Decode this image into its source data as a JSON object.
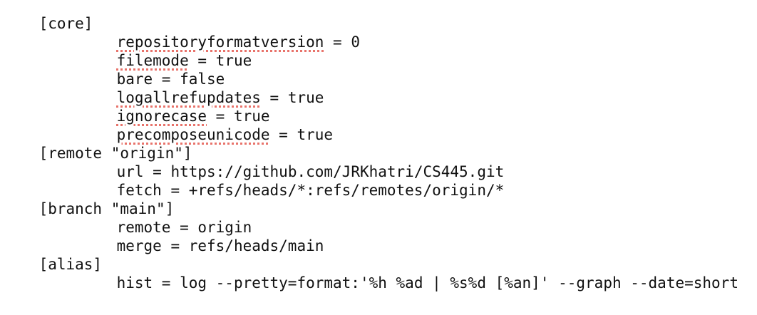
{
  "document": {
    "lines": [
      {
        "type": "section",
        "text": "[core]"
      },
      {
        "type": "kv",
        "key": "repositoryformatversion",
        "sep": " = ",
        "value": "0",
        "misspelled": true
      },
      {
        "type": "kv",
        "key": "filemode",
        "sep": " = ",
        "value": "true",
        "misspelled": true
      },
      {
        "type": "kv",
        "key": "bare",
        "sep": " = ",
        "value": "false",
        "misspelled": false
      },
      {
        "type": "kv",
        "key": "logallrefupdates",
        "sep": " = ",
        "value": "true",
        "misspelled": true
      },
      {
        "type": "kv",
        "key": "ignorecase",
        "sep": " = ",
        "value": "true",
        "misspelled": true
      },
      {
        "type": "kv",
        "key": "precomposeunicode",
        "sep": " = ",
        "value": "true",
        "misspelled": true
      },
      {
        "type": "section",
        "text": "[remote \"origin\"]"
      },
      {
        "type": "kv",
        "key": "url",
        "sep": " = ",
        "value": "https://github.com/JRKhatri/CS445.git",
        "misspelled": false
      },
      {
        "type": "kv",
        "key": "fetch",
        "sep": " = ",
        "value": "+refs/heads/*:refs/remotes/origin/*",
        "misspelled": false
      },
      {
        "type": "section",
        "text": "[branch \"main\"]"
      },
      {
        "type": "kv",
        "key": "remote",
        "sep": " = ",
        "value": "origin",
        "misspelled": false
      },
      {
        "type": "kv",
        "key": "merge",
        "sep": " = ",
        "value": "refs/heads/main",
        "misspelled": false
      },
      {
        "type": "section",
        "text": "[alias]"
      },
      {
        "type": "kv",
        "key": "hist",
        "sep": " = ",
        "value": "log --pretty=format:'%h %ad | %s%d [%an]' --graph --date=short",
        "misspelled": false
      }
    ]
  },
  "colors": {
    "text": "#111111",
    "spellcheck_underline": "#e8736b",
    "background": "#ffffff"
  }
}
